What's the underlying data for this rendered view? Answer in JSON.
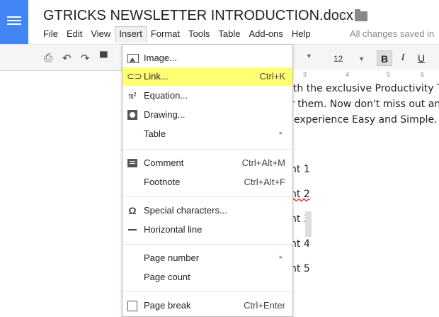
{
  "app": {
    "doc_title": "GTRICKS NEWSLETTER INTRODUCTION.docx",
    "save_status": "All changes saved in"
  },
  "menubar": [
    "File",
    "Edit",
    "View",
    "Insert",
    "Format",
    "Tools",
    "Table",
    "Add-ons",
    "Help"
  ],
  "toolbar": {
    "font_size": "12",
    "bold": "B",
    "italic": "I",
    "underline": "U"
  },
  "ruler": [
    "3",
    "4",
    "5",
    "6"
  ],
  "document": {
    "lines": [
      "ith the exclusive Productivity Tip",
      "r them. Now don't miss out any",
      "experience Easy and Simple.",
      "nt 1",
      "nt 2",
      "nt 3",
      "nt 4",
      "nt 5"
    ]
  },
  "insert_menu": {
    "items": [
      {
        "label": "Image...",
        "shortcut": "",
        "icon": "image-icon"
      },
      {
        "label": "Link...",
        "shortcut": "Ctrl+K",
        "icon": "link-icon",
        "highlighted": true
      },
      {
        "label": "Equation...",
        "shortcut": "",
        "icon": "equation-icon"
      },
      {
        "label": "Drawing...",
        "shortcut": "",
        "icon": "drawing-icon"
      },
      {
        "label": "Table",
        "shortcut": "",
        "icon": "",
        "submenu": true
      },
      {
        "label": "Comment",
        "shortcut": "Ctrl+Alt+M",
        "icon": "comment-icon"
      },
      {
        "label": "Footnote",
        "shortcut": "Ctrl+Alt+F",
        "icon": ""
      },
      {
        "label": "Special characters...",
        "shortcut": "",
        "icon": "omega-icon"
      },
      {
        "label": "Horizontal line",
        "shortcut": "",
        "icon": "horizontal-line-icon"
      },
      {
        "label": "Page number",
        "shortcut": "",
        "icon": "",
        "submenu": true
      },
      {
        "label": "Page count",
        "shortcut": "",
        "icon": ""
      },
      {
        "label": "Page break",
        "shortcut": "Ctrl+Enter",
        "icon": "page-break-icon"
      }
    ],
    "equation_glyph": "π²",
    "special_glyph": "Ω"
  },
  "colors": {
    "brand": "#4285f4",
    "highlight": "#ffff73"
  }
}
